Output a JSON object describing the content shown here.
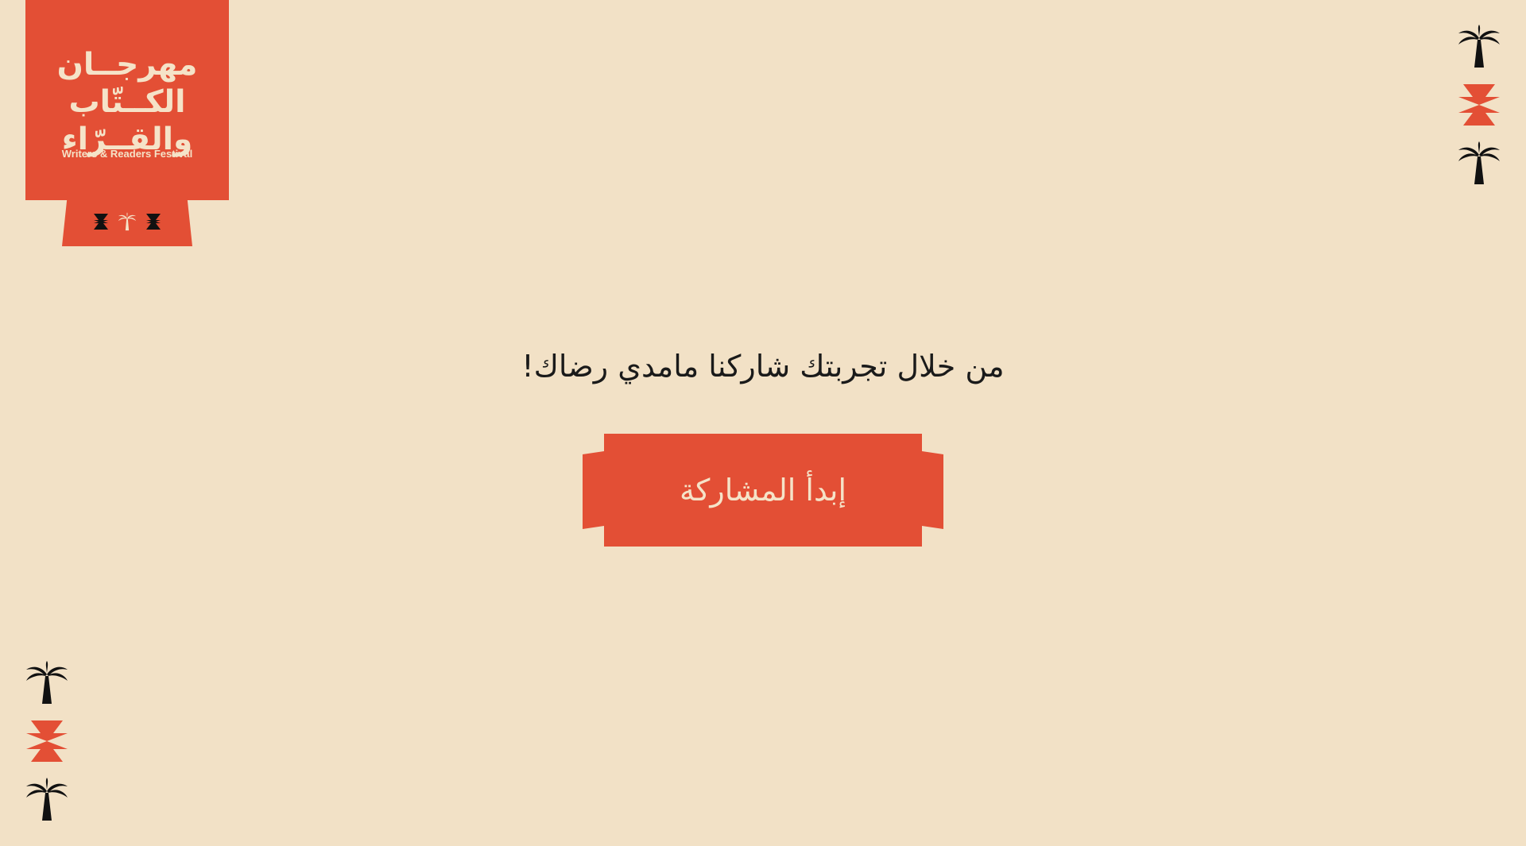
{
  "colors": {
    "background": "#f2e1c6",
    "accent": "#e34f35",
    "text": "#1a1a1a",
    "logo_text": "#f5e3c8",
    "icon_dark": "#111111"
  },
  "logo": {
    "arabic_line1": "مهرجــان",
    "arabic_line2": "الكــتّاب",
    "arabic_line3": "والقــرّاء",
    "english": "Writers & Readers Festival",
    "tab_icons": [
      "star-ornament-icon",
      "palm-tree-icon",
      "star-ornament-icon"
    ]
  },
  "decorations": {
    "top_right": [
      "palm-tree-icon",
      "ornament-icon",
      "palm-tree-icon"
    ],
    "bottom_left": [
      "palm-tree-icon",
      "ornament-icon",
      "palm-tree-icon"
    ]
  },
  "main": {
    "prompt": "من خلال تجربتك شاركنا مامدي رضاك!",
    "start_button_label": "إبدأ المشاركة"
  }
}
